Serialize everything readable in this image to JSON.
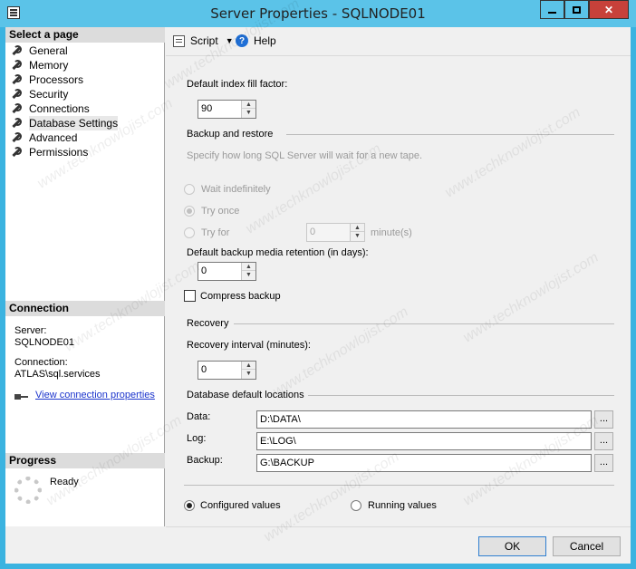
{
  "window": {
    "title": "Server Properties - SQLNODE01",
    "min_label": "",
    "close_glyph": "✕"
  },
  "left": {
    "select_page_header": "Select a page",
    "pages": [
      {
        "label": "General",
        "selected": false
      },
      {
        "label": "Memory",
        "selected": false
      },
      {
        "label": "Processors",
        "selected": false
      },
      {
        "label": "Security",
        "selected": false
      },
      {
        "label": "Connections",
        "selected": false
      },
      {
        "label": "Database Settings",
        "selected": true
      },
      {
        "label": "Advanced",
        "selected": false
      },
      {
        "label": "Permissions",
        "selected": false
      }
    ],
    "connection_header": "Connection",
    "server_label": "Server:",
    "server_value": "SQLNODE01",
    "connection_label": "Connection:",
    "connection_value": "ATLAS\\sql.services",
    "view_props_link": "View connection properties",
    "progress_header": "Progress",
    "progress_status": "Ready"
  },
  "toolbar": {
    "script_label": "Script",
    "help_label": "Help"
  },
  "main": {
    "fill_factor_label": "Default index fill factor:",
    "fill_factor_value": "90",
    "backup_restore_label": "Backup and restore",
    "tape_desc": "Specify how long SQL Server will wait for a new tape.",
    "wait_indef_label": "Wait indefinitely",
    "try_once_label": "Try once",
    "try_for_label": "Try for",
    "try_for_value": "0",
    "minutes_label": "minute(s)",
    "retention_label": "Default backup media retention (in days):",
    "retention_value": "0",
    "compress_backup_label": "Compress backup",
    "recovery_label": "Recovery",
    "recovery_interval_label": "Recovery interval (minutes):",
    "recovery_interval_value": "0",
    "db_locations_label": "Database default locations",
    "data_label": "Data:",
    "data_value": "D:\\DATA\\",
    "log_label": "Log:",
    "log_value": "E:\\LOG\\",
    "backup_label": "Backup:",
    "backup_value": "G:\\BACKUP",
    "browse_label": "...",
    "configured_label": "Configured values",
    "running_label": "Running values"
  },
  "footer": {
    "ok_label": "OK",
    "cancel_label": "Cancel"
  },
  "watermark": "www.techknowlojist.com"
}
